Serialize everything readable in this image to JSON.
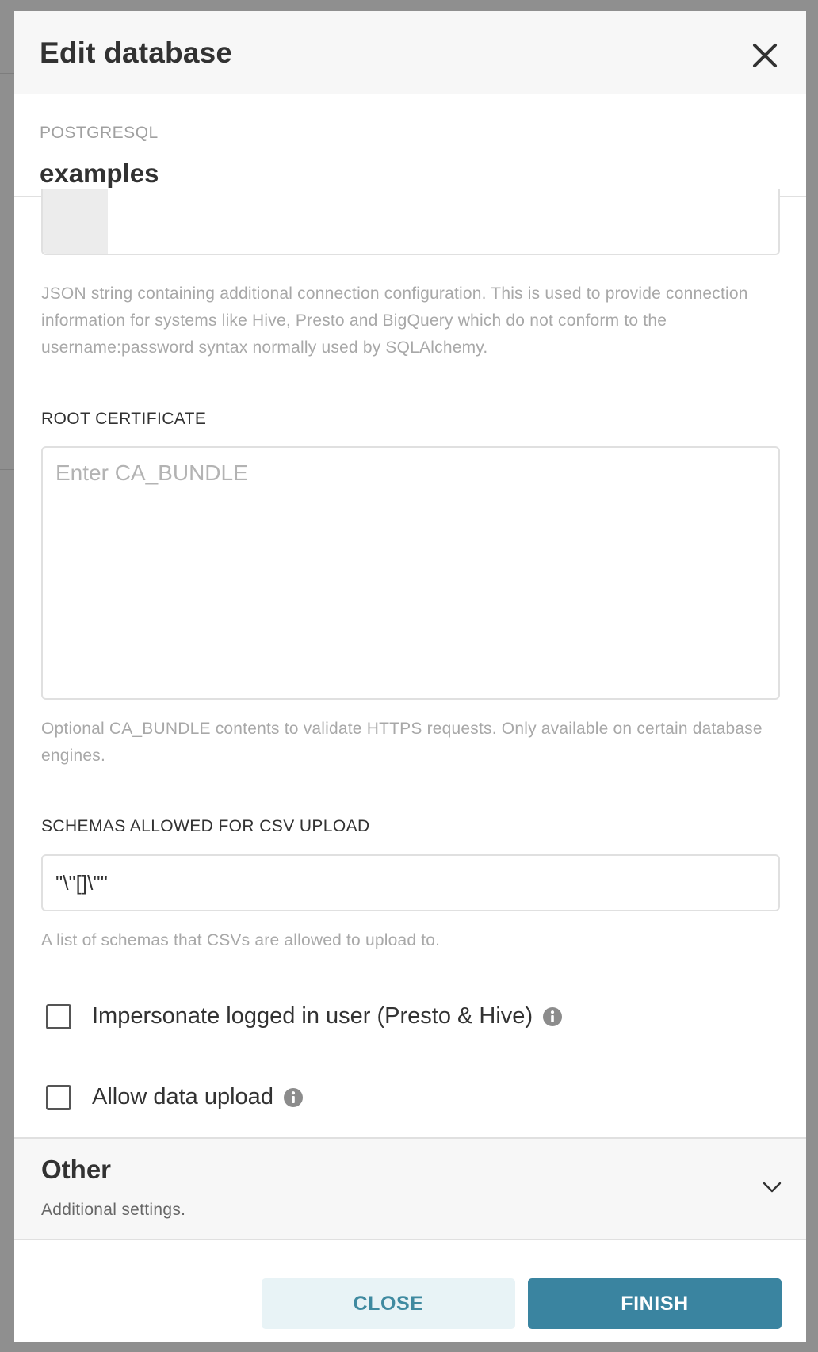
{
  "modal": {
    "title": "Edit database"
  },
  "database": {
    "engine": "POSTGRESQL",
    "name": "examples"
  },
  "extra": {
    "helper": "JSON string containing additional connection configuration. This is used to provide connection information for systems like Hive, Presto and BigQuery which do not conform to the username:password syntax normally used by SQLAlchemy."
  },
  "root_certificate": {
    "label": "ROOT CERTIFICATE",
    "placeholder": "Enter CA_BUNDLE",
    "value": "",
    "helper": "Optional CA_BUNDLE contents to validate HTTPS requests. Only available on certain database engines."
  },
  "csv_schemas": {
    "label": "SCHEMAS ALLOWED FOR CSV UPLOAD",
    "value": "\"\\\"[]\\\"\"",
    "helper": "A list of schemas that CSVs are allowed to upload to."
  },
  "checkboxes": [
    {
      "label": "Impersonate logged in user (Presto & Hive)",
      "checked": false,
      "icon": "info-icon"
    },
    {
      "label": "Allow data upload",
      "checked": false,
      "icon": "info-icon"
    }
  ],
  "other_section": {
    "title": "Other",
    "subtitle": "Additional settings.",
    "icon": "chevron-down-icon"
  },
  "footer": {
    "close_label": "CLOSE",
    "finish_label": "FINISH"
  },
  "colors": {
    "primary": "#3a84a0",
    "secondary_bg": "#e8f3f6",
    "header_bg": "#f7f7f7"
  }
}
